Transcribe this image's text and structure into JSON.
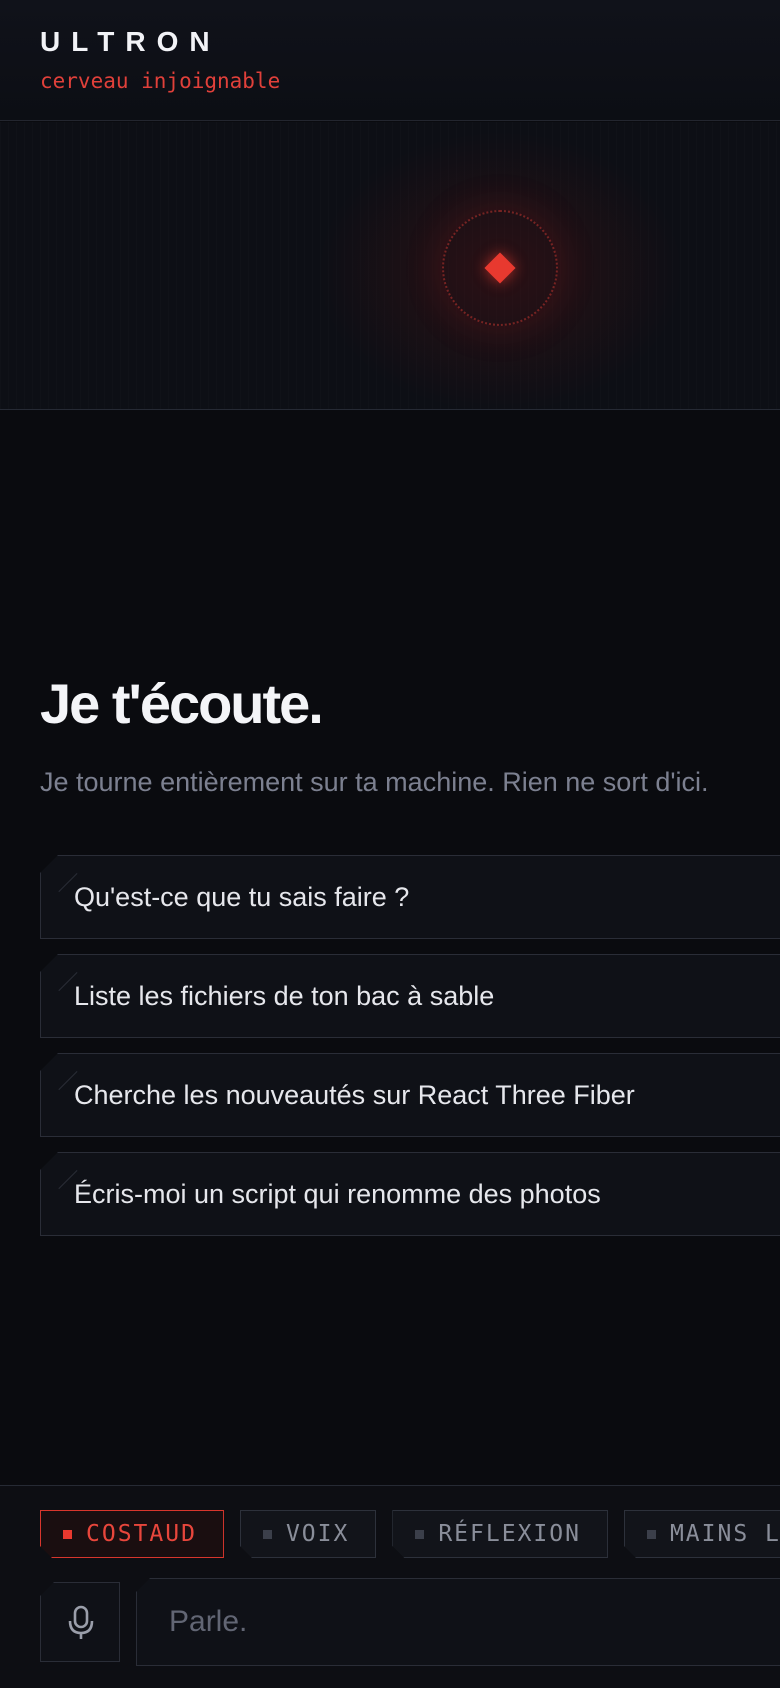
{
  "header": {
    "brand": "ULTRON",
    "status": "cerveau injoignable"
  },
  "hero": {
    "title": "Je t'écoute.",
    "subtitle": "Je tourne entièrement sur ta machine. Rien ne sort d'ici."
  },
  "suggestions": [
    {
      "label": "Qu'est-ce que tu sais faire ?"
    },
    {
      "label": "Liste les fichiers de ton bac à sable"
    },
    {
      "label": "Cherche les nouveautés sur React Three Fiber"
    },
    {
      "label": "Écris-moi un script qui renomme des photos"
    }
  ],
  "modes": [
    {
      "label": "COSTAUD",
      "active": true
    },
    {
      "label": "VOIX",
      "active": false
    },
    {
      "label": "RÉFLEXION",
      "active": false
    },
    {
      "label": "MAINS LIBRES",
      "active": false
    }
  ],
  "composer": {
    "placeholder": "Parle.",
    "mic_icon": "microphone-icon"
  },
  "colors": {
    "accent": "#e8392f",
    "background": "#0a0b0f",
    "muted_text": "#7c8090"
  }
}
